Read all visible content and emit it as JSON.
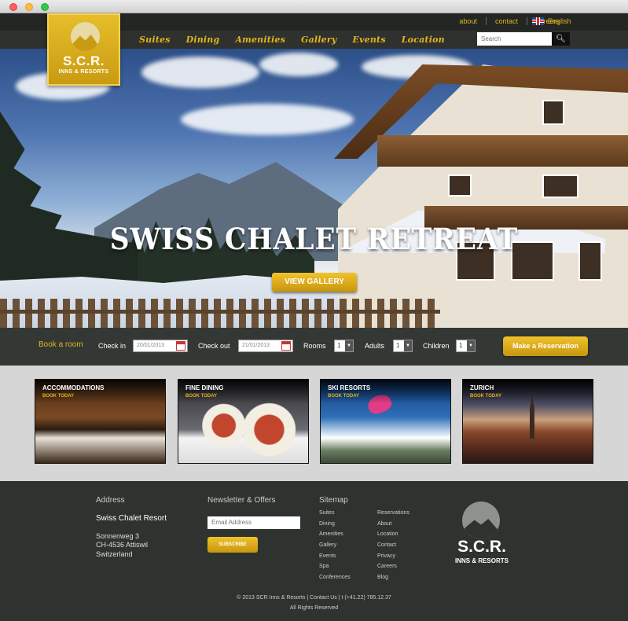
{
  "topbar": {
    "links": [
      "about",
      "contact",
      "careers"
    ],
    "language": "English"
  },
  "logo": {
    "line1": "S.C.R.",
    "line2": "INNS & RESORTS"
  },
  "nav": {
    "items": [
      "Suites",
      "Dining",
      "Amenities",
      "Gallery",
      "Events",
      "Location"
    ]
  },
  "search": {
    "placeholder": "Search",
    "icon": "search-icon"
  },
  "hero": {
    "title": "SWISS CHALET RETREAT",
    "button": "VIEW GALLERY"
  },
  "booking": {
    "title": "Book a room",
    "checkin_label": "Check in",
    "checkin_value": "20/01/2013",
    "checkout_label": "Check out",
    "checkout_value": "21/01/2013",
    "rooms_label": "Rooms",
    "rooms_value": "1",
    "adults_label": "Adults",
    "adults_value": "1",
    "children_label": "Children",
    "children_value": "1",
    "reserve_button": "Make a Reservation"
  },
  "cards": [
    {
      "title": "ACCOMMODATIONS",
      "cta": "BOOK TODAY"
    },
    {
      "title": "FINE DINING",
      "cta": "BOOK TODAY"
    },
    {
      "title": "SKI RESORTS",
      "cta": "BOOK TODAY"
    },
    {
      "title": "ZURICH",
      "cta": "BOOK TODAY"
    }
  ],
  "footer": {
    "address_heading": "Address",
    "address_name": "Swiss Chalet Resort",
    "address_line1": "Sonnenweg 3",
    "address_line2": "CH-4536 Attiswil",
    "address_line3": "Switzerland",
    "newsletter_heading": "Newsletter & Offers",
    "email_placeholder": "Email Address",
    "subscribe_button": "SUBSCRIBE",
    "sitemap_heading": "Sitemap",
    "sitemap_col1": [
      "Suites",
      "Dining",
      "Amenities",
      "Gallery",
      "Events",
      "Spa",
      "Conferences"
    ],
    "sitemap_col2": [
      "Reservations",
      "About",
      "Location",
      "Contact",
      "Privacy",
      "Careers",
      "Blog"
    ],
    "logo_line1": "S.C.R.",
    "logo_line2": "INNS & RESORTS",
    "copyright": "© 2013 SCR Inns & Resorts  |  Contact Us  |  t (+41.22) 785.12.37",
    "rights": "All Rights Reserved"
  },
  "colors": {
    "accent": "#e3b51e",
    "dark": "#2f332f",
    "topbar": "#242624"
  }
}
